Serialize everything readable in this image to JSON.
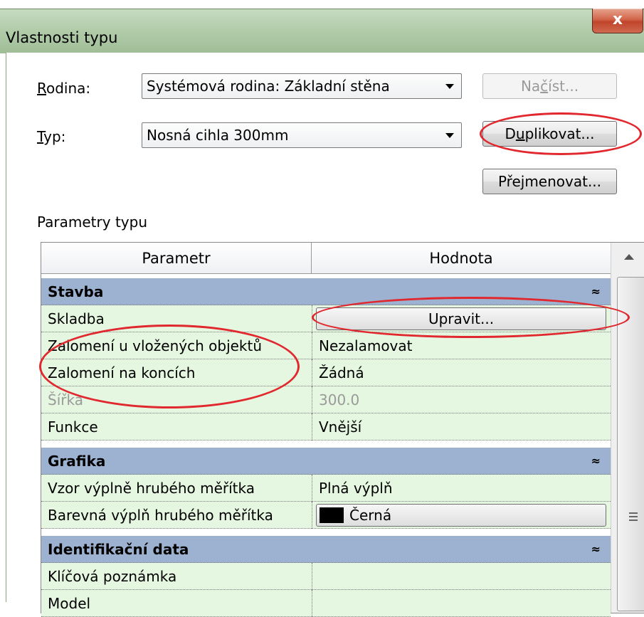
{
  "window": {
    "title": "Vlastnosti typu",
    "close_label": "x"
  },
  "form": {
    "rodina_label_first": "R",
    "rodina_label_rest": "odina:",
    "rodina_value": "Systémová rodina: Základní stěna",
    "typ_label_first": "T",
    "typ_label_rest": "yp:",
    "typ_value": "Nosná cihla 300mm"
  },
  "buttons": {
    "nacist_a": "Na",
    "nacist_u": "č",
    "nacist_b": "íst...",
    "duplikovat_a": "D",
    "duplikovat_u": "u",
    "duplikovat_b": "plikovat...",
    "prejmenovat_a": "Pře",
    "prejmenovat_u": "j",
    "prejmenovat_b": "menovat..."
  },
  "section_label": "Parametry typu",
  "table": {
    "headers": {
      "parametr": "Parametr",
      "hodnota": "Hodnota"
    },
    "groups": [
      {
        "name": "Stavba",
        "chevron": "≈"
      },
      {
        "name": "Grafika",
        "chevron": "≈"
      },
      {
        "name": "Identifikační data",
        "chevron": "≈"
      }
    ],
    "rows": {
      "skladba": {
        "param": "Skladba",
        "value": "Upravit..."
      },
      "zalomeni_objekty": {
        "param": "Zalomení u vložených objektů",
        "value": "Nezalamovat"
      },
      "zalomeni_konce": {
        "param": "Zalomení na koncích",
        "value": "Žádná"
      },
      "sirka": {
        "param": "Šířka",
        "value": "300.0"
      },
      "funkce": {
        "param": "Funkce",
        "value": "Vnější"
      },
      "vzor_vyplne": {
        "param": "Vzor výplně hrubého měřítka",
        "value": "Plná výplň"
      },
      "barevna_vypln": {
        "param": "Barevná výplň hrubého měřítka",
        "value": "Černá"
      },
      "klicova_poznamka": {
        "param": "Klíčová poznámka",
        "value": ""
      },
      "model": {
        "param": "Model",
        "value": ""
      }
    }
  },
  "colors": {
    "group_row": "#9cb2d0",
    "data_row": "#e6f7e1",
    "annotation": "#e0282e",
    "swatch": "#000000"
  }
}
